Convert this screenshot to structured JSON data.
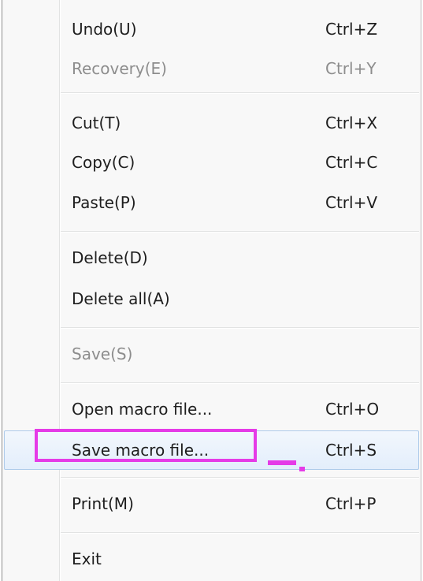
{
  "menu": {
    "items": [
      {
        "label": "Undo(U)",
        "shortcut": "Ctrl+Z",
        "enabled": true
      },
      {
        "label": "Recovery(E)",
        "shortcut": "Ctrl+Y",
        "enabled": false
      },
      {
        "label": "Cut(T)",
        "shortcut": "Ctrl+X",
        "enabled": true
      },
      {
        "label": "Copy(C)",
        "shortcut": "Ctrl+C",
        "enabled": true
      },
      {
        "label": "Paste(P)",
        "shortcut": "Ctrl+V",
        "enabled": true
      },
      {
        "label": "Delete(D)",
        "shortcut": "",
        "enabled": true
      },
      {
        "label": "Delete all(A)",
        "shortcut": "",
        "enabled": true
      },
      {
        "label": "Save(S)",
        "shortcut": "",
        "enabled": false
      },
      {
        "label": "Open macro file...",
        "shortcut": "Ctrl+O",
        "enabled": true
      },
      {
        "label": "Save macro file...",
        "shortcut": "Ctrl+S",
        "enabled": true,
        "highlighted": true
      },
      {
        "label": "Print(M)",
        "shortcut": "Ctrl+P",
        "enabled": true
      },
      {
        "label": "Exit",
        "shortcut": "",
        "enabled": true
      }
    ]
  },
  "colors": {
    "annotation": "#e53be7",
    "highlight_border": "#aecbea",
    "disabled_text": "#8d8d8d",
    "text": "#1e1e1e"
  }
}
